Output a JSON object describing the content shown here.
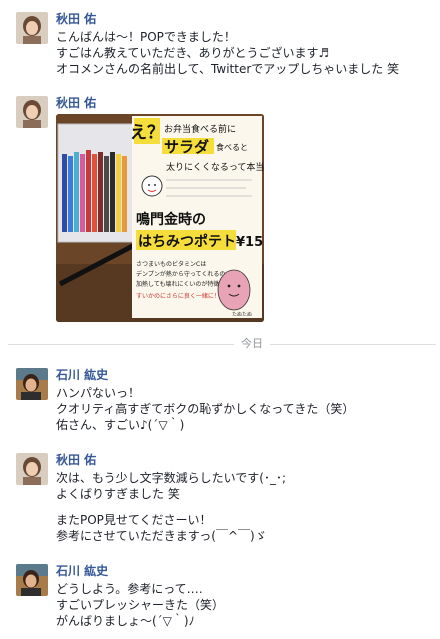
{
  "messages": [
    {
      "sender": "秋田 佑",
      "lines": [
        "こんばんは～！POPできました！",
        "すごはん教えていただき、ありがとうございます♬",
        "オコメンさんの名前出して、Twitterでアップしちゃいました 笑"
      ]
    },
    {
      "sender": "秋田 佑",
      "photo": {
        "top_text_1": "え？",
        "top_text_2": "お弁当食べる前に",
        "top_text_3": "サラダ",
        "top_text_4": "食べると",
        "top_text_5": "太りにくくなるって本当…",
        "mid_text_1": "鳴門金時の",
        "mid_text_2": "はちみつポテト",
        "price": "¥15",
        "note_1": "さつまいものビタミンCは",
        "note_2": "デンプンが熱から守ってくれるので",
        "note_3": "加熱しても壊れにくいのが特徴",
        "note_4": "すいかのにさらに良く一緒に！",
        "signature": "たぬたぬ"
      }
    },
    {
      "sender": "石川 紘史",
      "lines": [
        "ハンパないっ！",
        "クオリティ高すぎてボクの恥ずかしくなってきた（笑）",
        "佑さん、すごい♪(´▽｀)"
      ]
    },
    {
      "sender": "秋田 佑",
      "lines": [
        "次は、もう少し文字数減らしたいです(･_･;",
        "よくばりすぎました 笑"
      ],
      "lines2": [
        "またPOP見せてくださーい！",
        "参考にさせていただきますっ(￣^￣)ゞ"
      ]
    },
    {
      "sender": "石川 紘史",
      "lines": [
        "どうしよう。参考にって‥‥",
        "すごいプレッシャーきた（笑）",
        "がんばりましょ〜(´▽｀)ﾉ"
      ]
    }
  ],
  "divider": {
    "label": "今日"
  },
  "colors": {
    "sender": "#365899",
    "text": "#1d2129",
    "divider": "#dddfe2",
    "divider_text": "#90949c"
  }
}
